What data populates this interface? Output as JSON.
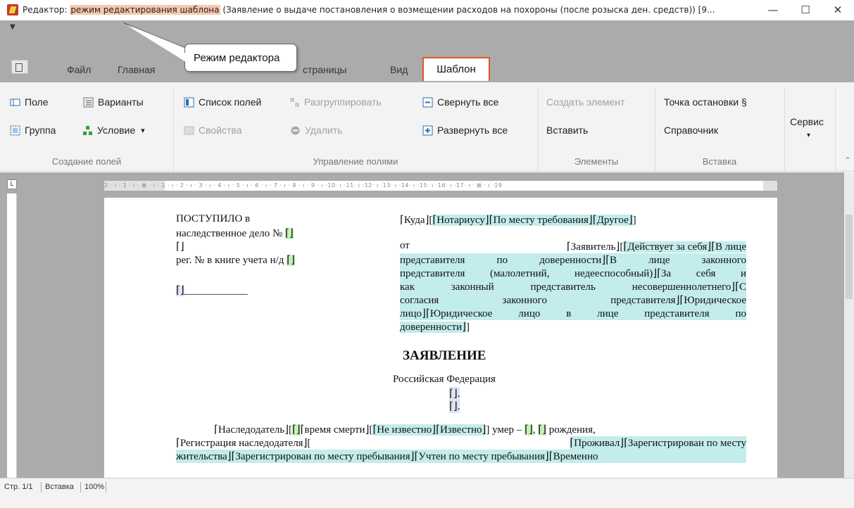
{
  "titlebar": {
    "prefix": "Редактор: ",
    "mode_highlight": "режим редактирования шаблона",
    "document": " (Заявление о выдаче постановления о возмещении расходов на похороны (после розыска ден. средств)) [9...",
    "minimize": "—",
    "maximize": "☐",
    "close": "✕"
  },
  "qat": {
    "arrow": "▼"
  },
  "tabs": [
    "Файл",
    "Главная",
    "страницы",
    "Вид"
  ],
  "active_tab": "Шаблон",
  "callout": "Режим редактора",
  "ribbon": {
    "pole": "Поле",
    "varianty": "Варианты",
    "gruppa": "Группа",
    "uslovie": "Условие",
    "uslovie_arrow": "▾",
    "spisok_poley": "Список полей",
    "razgruppirovat": "Разгруппировать",
    "svoystva": "Свойства",
    "udalit": "Удалить",
    "svernut": "Свернуть все",
    "razvernut": "Развернуть все",
    "sozdat": "Создать элемент",
    "vstavit": "Вставить",
    "tochka": "Точка остановки §",
    "spravochnik": "Справочник",
    "servis": "Сервис",
    "servis_arrow": "▾",
    "groups": [
      "Создание полей",
      "Управление полями",
      "Элементы",
      "Вставка"
    ]
  },
  "ruler": {
    "corner": "L",
    "ticks": "2 · ı · 1 · ı · ⊠ · ı · 1 · ı · 2 · ı · 3 · ı · 4 · ı · 5 · ı · 6 · ı · 7 · ı · 8 · ı · 9 · ı ·10· ı ·11· ı ·12· ı ·13· ı ·14· ı ·15· ı ·16· ı ·17· ı · ⊠ · ı ·19"
  },
  "doc": {
    "left1": "ПОСТУПИЛО в",
    "left2": "наследственное дело №",
    "left3": "⌈⌋",
    "left4": "рег. № в книге учета н/д",
    "left5_field": "⌈⌋",
    "left5_line": "____________",
    "empty_field": "⌈⌋",
    "right1_pre": "⌈Куда⌋[",
    "right1_f1": "⌈Нотариусу⌋",
    "right1_f2": "⌈По месту требования⌋",
    "right1_f3": "⌈Другое⌋",
    "right1_post": "]",
    "right2_ot": "от",
    "right2_zayavitel": "⌈Заявитель⌋[",
    "right2_rest": "⌈Действует за себя⌋⌈В лице",
    "right3": "представителя по доверенности⌋⌈В лице законного",
    "right4": "представителя (малолетний, недееспособный)⌋⌈За себя и",
    "right5": "как законный представитель несовершеннолетнего⌋⌈С",
    "right6": "согласия законного представителя⌋⌈Юридическое",
    "right7": "лицо⌋⌈Юридическое лицо в лице представителя по",
    "right8": "доверенности⌋",
    "right8_post": "]",
    "heading": "ЗАЯВЛЕНИЕ",
    "federation": "Российская Федерация",
    "small_field1": "⌈⌋.",
    "small_field2": "⌈⌋.",
    "p1_a": "⌈Наследодатель⌋[",
    "p1_b": "⌈⌋",
    "p1_c": "⌈время смерти⌋[",
    "p1_d": "⌈Не известно⌋⌈Известно⌋",
    "p1_e": "] умер – ",
    "p1_f": "⌈⌋",
    "p1_g": ", ",
    "p1_h": "⌈⌋",
    "p1_i": " рождения,",
    "p2_a": "⌈Регистрация наследодателя⌋[",
    "p2_b": "⌈Проживал⌋⌈Зарегистрирован по месту",
    "p3": "жительства⌋⌈Зарегистрирован по месту пребывания⌋⌈Учтен по месту пребывания⌋⌈Временно"
  },
  "status": {
    "page": "Стр. 1/1",
    "mode": "Вставка",
    "zoom": "100%"
  }
}
